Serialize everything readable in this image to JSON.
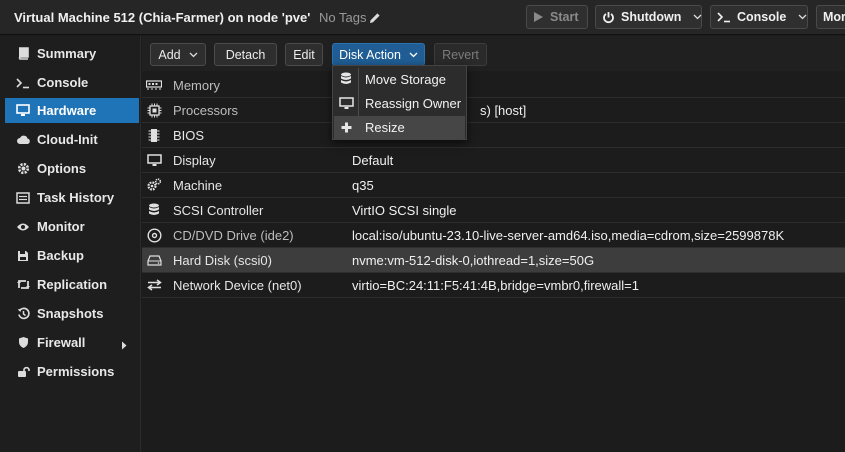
{
  "header": {
    "vm_title": "Virtual Machine 512 (Chia-Farmer) on node 'pve'",
    "tags_label": "No Tags",
    "buttons": {
      "start": "Start",
      "shutdown": "Shutdown",
      "console": "Console",
      "more": "Mor"
    }
  },
  "sidebar": {
    "items": [
      {
        "label": "Summary",
        "icon": "book-icon"
      },
      {
        "label": "Console",
        "icon": "terminal-icon"
      },
      {
        "label": "Hardware",
        "icon": "desktop-icon"
      },
      {
        "label": "Cloud-Init",
        "icon": "cloud-icon"
      },
      {
        "label": "Options",
        "icon": "gear-icon"
      },
      {
        "label": "Task History",
        "icon": "list-icon"
      },
      {
        "label": "Monitor",
        "icon": "eye-icon"
      },
      {
        "label": "Backup",
        "icon": "floppy-icon"
      },
      {
        "label": "Replication",
        "icon": "retweet-icon"
      },
      {
        "label": "Snapshots",
        "icon": "history-icon"
      },
      {
        "label": "Firewall",
        "icon": "shield-icon"
      },
      {
        "label": "Permissions",
        "icon": "unlock-icon"
      }
    ],
    "active": "Hardware"
  },
  "toolbar": {
    "add": "Add",
    "detach": "Detach",
    "edit": "Edit",
    "disk_action": "Disk Action",
    "revert": "Revert"
  },
  "disk_action_menu": {
    "items": [
      {
        "label": "Move Storage",
        "icon": "database-icon"
      },
      {
        "label": "Reassign Owner",
        "icon": "desktop-icon"
      },
      {
        "label": "Resize",
        "icon": "plus-icon"
      }
    ]
  },
  "hardware": {
    "rows": [
      {
        "name": "Memory",
        "value": "",
        "icon": "memory-icon"
      },
      {
        "name": "Processors",
        "value": "s) [host]",
        "icon": "cpu-icon"
      },
      {
        "name": "BIOS",
        "value": "",
        "icon": "microchip-icon"
      },
      {
        "name": "Display",
        "value": "Default",
        "icon": "desktop-icon"
      },
      {
        "name": "Machine",
        "value": "q35",
        "icon": "cogs-icon"
      },
      {
        "name": "SCSI Controller",
        "value": "VirtIO SCSI single",
        "icon": "database-icon"
      },
      {
        "name": "CD/DVD Drive (ide2)",
        "value": "local:iso/ubuntu-23.10-live-server-amd64.iso,media=cdrom,size=2599878K",
        "icon": "disc-icon"
      },
      {
        "name": "Hard Disk (scsi0)",
        "value": "nvme:vm-512-disk-0,iothread=1,size=50G",
        "icon": "hdd-icon"
      },
      {
        "name": "Network Device (net0)",
        "value": "virtio=BC:24:11:F5:41:4B,bridge=vmbr0,firewall=1",
        "icon": "exchange-icon"
      }
    ],
    "selected_row": "Hard Disk (scsi0)"
  },
  "colors": {
    "accent": "#1f74b8",
    "primary_button": "#1f5d94",
    "background": "#1c1c1c"
  }
}
